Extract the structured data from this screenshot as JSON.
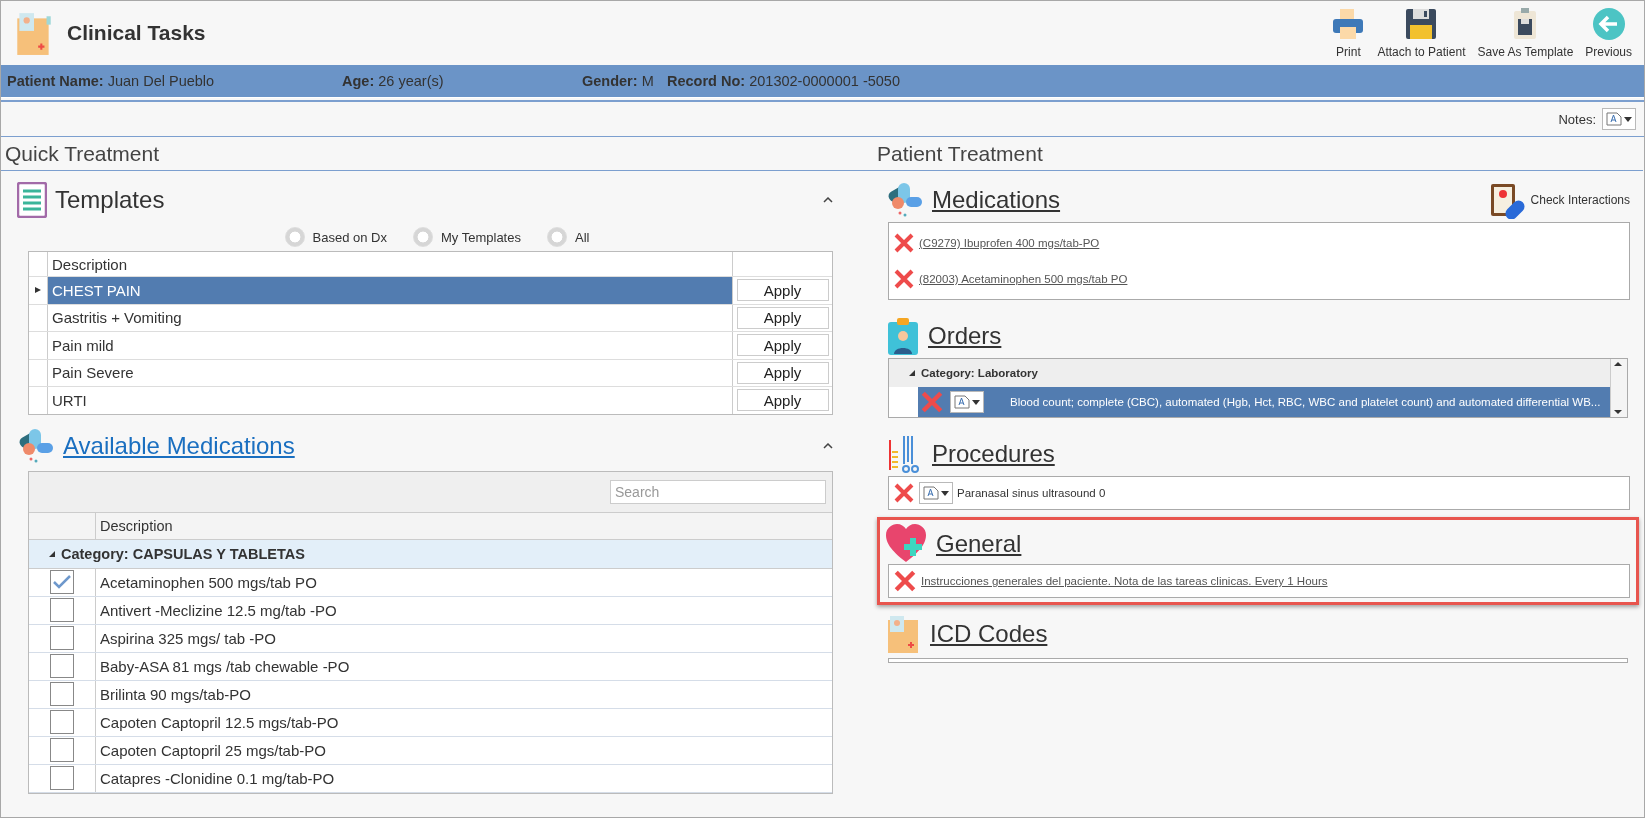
{
  "window": {
    "title": "Clinical Tasks"
  },
  "toolbar": [
    {
      "kind": "print",
      "label": "Print"
    },
    {
      "kind": "attach",
      "label": "Attach to Patient"
    },
    {
      "kind": "template",
      "label": "Save As Template"
    },
    {
      "kind": "previous",
      "label": "Previous"
    }
  ],
  "patient_bar": [
    {
      "label": "Patient Name:",
      "value": "Juan Del Pueblo"
    },
    {
      "label": "Age:",
      "value": "26 year(s)"
    },
    {
      "label": "Gender:",
      "value": "M"
    },
    {
      "label": "Record No:",
      "value": "201302-0000001 -5050"
    }
  ],
  "notes": {
    "label": "Notes:"
  },
  "quick_treatment": {
    "title": "Quick Treatment",
    "templates": {
      "title": "Templates",
      "expanded": true,
      "filters": [
        {
          "label": "Based on Dx",
          "selected": false
        },
        {
          "label": "My Templates",
          "selected": false
        },
        {
          "label": "All",
          "selected": false
        }
      ],
      "column": "Description",
      "rows": [
        {
          "description": "CHEST PAIN",
          "selected": true,
          "action": "Apply"
        },
        {
          "description": "Gastritis + Vomiting",
          "selected": false,
          "action": "Apply"
        },
        {
          "description": "Pain mild",
          "selected": false,
          "action": "Apply"
        },
        {
          "description": "Pain Severe",
          "selected": false,
          "action": "Apply"
        },
        {
          "description": "URTI",
          "selected": false,
          "action": "Apply"
        }
      ]
    },
    "available_medications": {
      "title": "Available Medications",
      "expanded": true,
      "search": {
        "placeholder": "Search"
      },
      "column": "Description",
      "category": "Category: CAPSULAS Y TABLETAS",
      "rows": [
        {
          "description": "Acetaminophen 500 mgs/tab PO",
          "checked": true
        },
        {
          "description": "Antivert -Meclizine 12.5 mg/tab -PO",
          "checked": false
        },
        {
          "description": "Aspirina 325 mgs/ tab -PO",
          "checked": false
        },
        {
          "description": "Baby-ASA 81 mgs /tab chewable -PO",
          "checked": false
        },
        {
          "description": "Brilinta 90 mgs/tab-PO",
          "checked": false
        },
        {
          "description": "Capoten Captopril 12.5 mgs/tab-PO",
          "checked": false
        },
        {
          "description": "Capoten Captopril 25 mgs/tab-PO",
          "checked": false
        },
        {
          "description": "Catapres -Clonidine 0.1 mg/tab-PO",
          "checked": false
        }
      ]
    }
  },
  "patient_treatment": {
    "title": "Patient Treatment",
    "sections": [
      {
        "kind": "medications",
        "title": "Medications",
        "highlighted": false,
        "action": "Check Interactions",
        "items": [
          {
            "text": "(C9279) Ibuprofen 400 mgs/tab-PO"
          },
          {
            "text": "(82003) Acetaminophen 500 mgs/tab  PO"
          }
        ]
      },
      {
        "kind": "orders",
        "title": "Orders",
        "highlighted": false,
        "category": "Category: Laboratory",
        "items": [
          {
            "text": "Blood count; complete (CBC), automated (Hgb, Hct, RBC, WBC and platelet count) and automated differential WB...",
            "selected": true
          }
        ]
      },
      {
        "kind": "procedures",
        "title": "Procedures",
        "highlighted": false,
        "items": [
          {
            "text": "Paranasal sinus ultrasound 0"
          }
        ]
      },
      {
        "kind": "general",
        "title": "General",
        "highlighted": true,
        "items": [
          {
            "text": "Instrucciones generales del paciente.  Nota de las tareas clinicas. Every 1 Hours"
          }
        ]
      },
      {
        "kind": "icd",
        "title": "ICD Codes",
        "highlighted": false
      }
    ]
  }
}
